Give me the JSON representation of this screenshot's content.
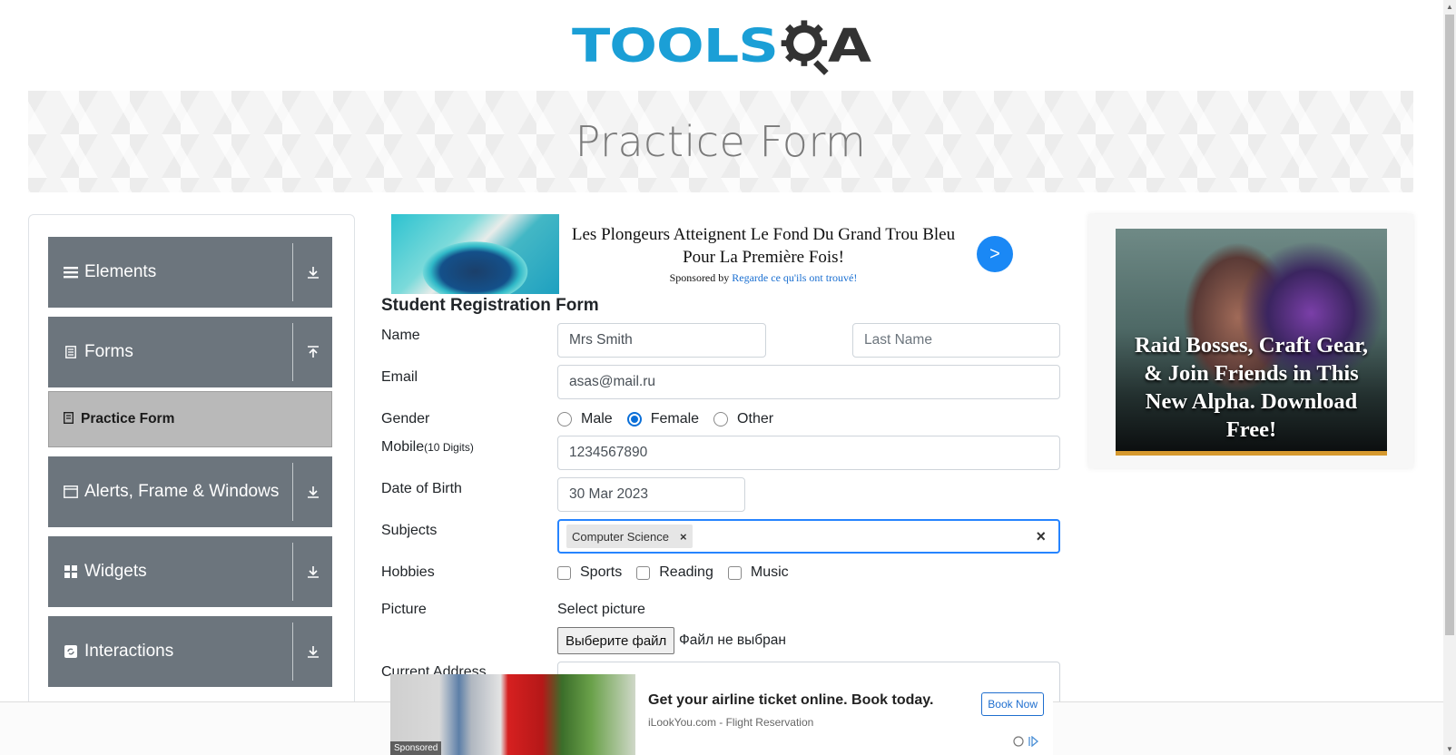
{
  "header": {
    "logo_main": "TOOLS",
    "logo_end": "A",
    "logo_alt": "TOOLSQA"
  },
  "banner": {
    "title": "Practice Form"
  },
  "sidebar": {
    "groups": [
      {
        "label": "Elements",
        "icon": "menu-icon",
        "arrow": "download-icon"
      },
      {
        "label": "Forms",
        "icon": "document-icon",
        "arrow": "upload-icon"
      },
      {
        "label": "Alerts, Frame & Windows",
        "icon": "window-icon",
        "arrow": "download-icon"
      },
      {
        "label": "Widgets",
        "icon": "grid-icon",
        "arrow": "download-icon"
      },
      {
        "label": "Interactions",
        "icon": "refresh-icon",
        "arrow": "download-icon"
      }
    ],
    "active_item": {
      "label": "Practice Form",
      "icon": "form-icon"
    }
  },
  "top_ad": {
    "title": "Les Plongeurs Atteignent Le Fond Du Grand Trou Bleu Pour La Première Fois!",
    "sponsored_prefix": "Sponsored by",
    "sponsor": "Regarde ce qu'ils ont trouvé!",
    "button": ">"
  },
  "form": {
    "title": "Student Registration Form",
    "name_label": "Name",
    "first_name_value": "Mrs Smith",
    "last_name_placeholder": "Last Name",
    "email_label": "Email",
    "email_value": "asas@mail.ru",
    "gender_label": "Gender",
    "gender_options": [
      "Male",
      "Female",
      "Other"
    ],
    "gender_selected": "Female",
    "mobile_label": "Mobile",
    "mobile_hint": "(10 Digits)",
    "mobile_value": "1234567890",
    "dob_label": "Date of Birth",
    "dob_value": "30 Mar 2023",
    "subjects_label": "Subjects",
    "subjects": [
      "Computer Science"
    ],
    "chip_remove": "×",
    "subjects_clear": "×",
    "hobbies_label": "Hobbies",
    "hobbies": [
      "Sports",
      "Reading",
      "Music"
    ],
    "picture_label": "Picture",
    "select_picture": "Select picture",
    "file_button": "Выберите файл",
    "file_status": "Файл не выбран",
    "address_label": "Current Address"
  },
  "right_ad": {
    "text": "Raid Bosses, Craft Gear, & Join Friends in This New Alpha. Download Free!"
  },
  "bottom_ad": {
    "sponsored": "Sponsored",
    "title": "Get your airline ticket online. Book today.",
    "subtitle": "iLookYou.com - Flight Reservation",
    "button": "Book Now"
  },
  "colors": {
    "accent": "#1b9fd6",
    "sidebar_bg": "#6c757d",
    "active_item_bg": "#b9b9b9",
    "radio_checked": "#0a6fd8",
    "focus_border": "#2684ff"
  }
}
